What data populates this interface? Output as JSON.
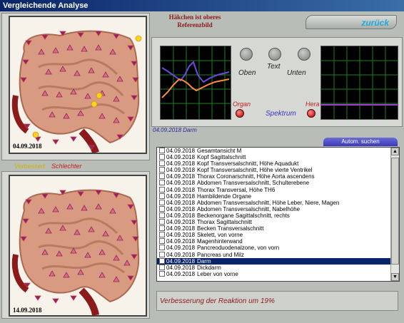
{
  "window": {
    "title": "Vergleichende Analyse"
  },
  "hint": {
    "line1": "Häkchen ist oberes",
    "line2": "Referenzbild"
  },
  "back_button": {
    "label": "zurück"
  },
  "images": {
    "top": {
      "date": "04.09.2018"
    },
    "bottom": {
      "date": "14.09.2018"
    }
  },
  "filter": {
    "improved": "Verbessert",
    "worse": "Schlechter"
  },
  "controls": {
    "top_label": "Oben",
    "text_label": "Text",
    "bottom_label": "Unten",
    "organ_label": "Organ",
    "spectrum_label": "Spektrum",
    "hera_label": "Hera"
  },
  "current": {
    "caption": "04.09.2018 Darm"
  },
  "auto_search": {
    "label": "Autom. suchen"
  },
  "list": {
    "items": [
      {
        "date": "04.09.2018",
        "text": "Gesamtansicht M",
        "selected": false
      },
      {
        "date": "04.09.2018",
        "text": "Kopf Sagittalschnitt",
        "selected": false
      },
      {
        "date": "04.09.2018",
        "text": "Kopf Transversalschnitt, Höhe Aquadukt",
        "selected": false
      },
      {
        "date": "04.09.2018",
        "text": "Kopf Transversalschnitt, Höhe vierte Ventrikel",
        "selected": false
      },
      {
        "date": "04.09.2018",
        "text": "Thorax Coronarschnitt, Höhe Aorta ascendens",
        "selected": false
      },
      {
        "date": "04.09.2018",
        "text": "Abdomen Transversalschnitt, Schulterebene",
        "selected": false
      },
      {
        "date": "04.09.2018",
        "text": "Thorax Transversal, Höhe TH6",
        "selected": false
      },
      {
        "date": "04.09.2018",
        "text": "Hambildende Organe",
        "selected": false
      },
      {
        "date": "04.09.2018",
        "text": "Abdomen Transversalschnitt, Höhe Leber, Niere, Magen",
        "selected": false
      },
      {
        "date": "04.09.2018",
        "text": "Abdomen Transversalschnitt, Nabelhöhe",
        "selected": false
      },
      {
        "date": "04.09.2018",
        "text": "Beckenorgane Sagittalschnitt, rechts",
        "selected": false
      },
      {
        "date": "04.09.2018",
        "text": "Thorax Sagittalschnitt",
        "selected": false
      },
      {
        "date": "04.09.2018",
        "text": "Becken Transversalschnitt",
        "selected": false
      },
      {
        "date": "04.09.2018",
        "text": "Skelett, von vorne",
        "selected": false
      },
      {
        "date": "04.09.2018",
        "text": "Magenhinterwand",
        "selected": false
      },
      {
        "date": "04.09.2018",
        "text": "Pancreoduodenalzone, von vorn",
        "selected": false
      },
      {
        "date": "04.09.2018",
        "text": "Pancreas und Milz",
        "selected": false
      },
      {
        "date": "04.09.2018",
        "text": "Darm",
        "selected": true
      },
      {
        "date": "04.09.2018",
        "text": "Dickdarm",
        "selected": false
      },
      {
        "date": "04.09.2018",
        "text": "Leber von vorne",
        "selected": false
      }
    ]
  },
  "status": {
    "message": "Verbesserung der Reaktion um 19%"
  },
  "colors": {
    "accent": "#1fa8d8",
    "selection": "#0a246a",
    "hint": "#8b1a1a",
    "organ": "#c21c1c",
    "spectrum": "#3535c4"
  }
}
